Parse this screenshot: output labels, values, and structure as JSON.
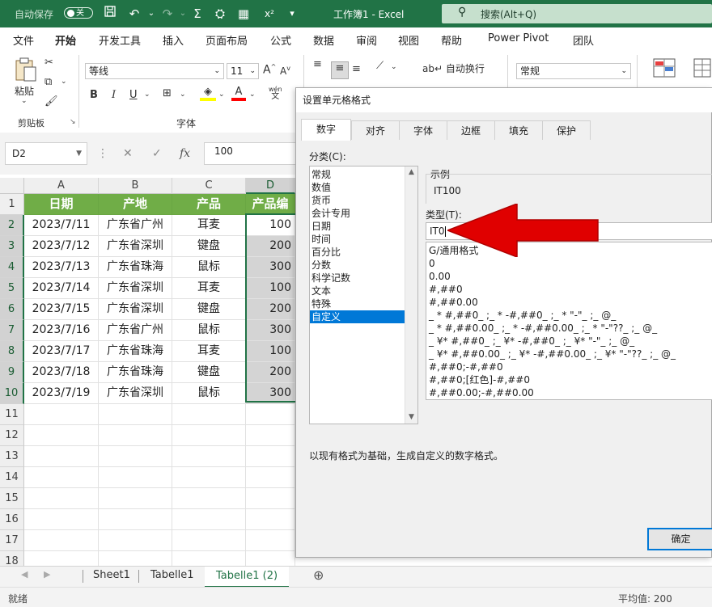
{
  "titlebar": {
    "autosave_label": "自动保存",
    "autosave_state": "关",
    "workbook_title": "工作簿1 - Excel",
    "search_placeholder": "搜索(Alt+Q)"
  },
  "menu": [
    "文件",
    "开始",
    "开发工具",
    "插入",
    "页面布局",
    "公式",
    "数据",
    "审阅",
    "视图",
    "帮助",
    "Power Pivot",
    "团队"
  ],
  "ribbon": {
    "paste_label": "粘贴",
    "clipboard_group": "剪贴板",
    "font_name": "等线",
    "font_size": "11",
    "font_group": "字体",
    "wrap_text": "自动换行",
    "number_format": "常规",
    "phonetic_label": "wén",
    "phonetic_char": "文"
  },
  "formula_bar": {
    "name_box": "D2",
    "formula_value": "100",
    "fx": "fx"
  },
  "sheet": {
    "columns": [
      "A",
      "B",
      "C",
      "D"
    ],
    "headers": [
      "日期",
      "产地",
      "产品",
      "产品编"
    ],
    "rows": [
      [
        "2023/7/11",
        "广东省广州",
        "耳麦",
        "100"
      ],
      [
        "2023/7/12",
        "广东省深圳",
        "键盘",
        "200"
      ],
      [
        "2023/7/13",
        "广东省珠海",
        "鼠标",
        "300"
      ],
      [
        "2023/7/14",
        "广东省深圳",
        "耳麦",
        "100"
      ],
      [
        "2023/7/15",
        "广东省深圳",
        "键盘",
        "200"
      ],
      [
        "2023/7/16",
        "广东省广州",
        "鼠标",
        "300"
      ],
      [
        "2023/7/17",
        "广东省珠海",
        "耳麦",
        "100"
      ],
      [
        "2023/7/18",
        "广东省珠海",
        "键盘",
        "200"
      ],
      [
        "2023/7/19",
        "广东省深圳",
        "鼠标",
        "300"
      ]
    ],
    "row_numbers": [
      "1",
      "2",
      "3",
      "4",
      "5",
      "6",
      "7",
      "8",
      "9",
      "10",
      "11",
      "12",
      "13",
      "14",
      "15",
      "16",
      "17",
      "18"
    ]
  },
  "sheet_tabs": [
    "Sheet1",
    "Tabelle1",
    "Tabelle1 (2)"
  ],
  "active_sheet": "Tabelle1 (2)",
  "status": {
    "ready": "就绪",
    "average": "平均值: 200"
  },
  "dialog": {
    "title": "设置单元格格式",
    "tabs": [
      "数字",
      "对齐",
      "字体",
      "边框",
      "填充",
      "保护"
    ],
    "category_label": "分类(C):",
    "categories": [
      "常规",
      "数值",
      "货币",
      "会计专用",
      "日期",
      "时间",
      "百分比",
      "分数",
      "科学记数",
      "文本",
      "特殊",
      "自定义"
    ],
    "selected_category": "自定义",
    "sample_label": "示例",
    "sample_value": "IT100",
    "type_label": "类型(T):",
    "type_value": "IT0",
    "formats": [
      "G/通用格式",
      "0",
      "0.00",
      "#,##0",
      "#,##0.00",
      "_ * #,##0_ ;_ * -#,##0_ ;_ * \"-\"_ ;_ @_",
      "_ * #,##0.00_ ;_ * -#,##0.00_ ;_ * \"-\"??_ ;_ @_",
      "_ ¥* #,##0_ ;_ ¥* -#,##0_ ;_ ¥* \"-\"_ ;_ @_",
      "_ ¥* #,##0.00_ ;_ ¥* -#,##0.00_ ;_ ¥* \"-\"??_ ;_ @_",
      "#,##0;-#,##0",
      "#,##0;[红色]-#,##0",
      "#,##0.00;-#,##0.00"
    ],
    "description": "以现有格式为基础，生成自定义的数字格式。",
    "ok_label": "确定"
  },
  "colors": {
    "excel_green": "#217346",
    "header_fill": "#70ad47",
    "selection_blue": "#0078d7",
    "arrow_red": "#e00000"
  }
}
